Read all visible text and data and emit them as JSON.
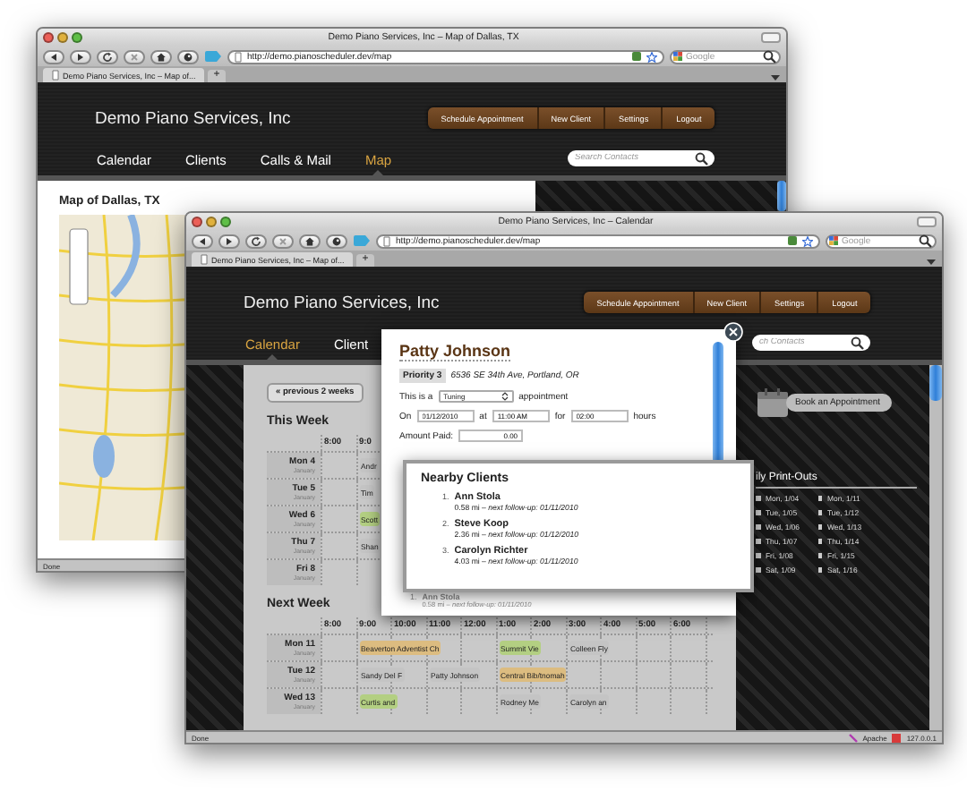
{
  "windows": [
    {
      "kind": "map",
      "title": "Demo Piano Services, Inc – Map of Dallas, TX",
      "url": "http://demo.pianoscheduler.dev/map",
      "web_search": {
        "placeholder": "Google"
      },
      "tab": "Demo Piano Services, Inc – Map of...",
      "new_tab": "+",
      "site": {
        "brand": "Demo Piano Services, Inc",
        "actions": [
          "Schedule Appointment",
          "New Client",
          "Settings",
          "Logout"
        ],
        "nav": [
          {
            "label": "Calendar",
            "selected": false
          },
          {
            "label": "Clients",
            "selected": false
          },
          {
            "label": "Calls & Mail",
            "selected": false
          },
          {
            "label": "Map",
            "selected": true
          }
        ],
        "search": {
          "placeholder": "Search Contacts"
        }
      },
      "map": {
        "title": "Map of Dallas, TX"
      },
      "status": [
        "Done"
      ]
    },
    {
      "kind": "calendar",
      "title": "Demo Piano Services, Inc – Calendar",
      "url": "http://demo.pianoscheduler.dev/map",
      "web_search": {
        "placeholder": "Google"
      },
      "tab": "Demo Piano Services, Inc – Map of...",
      "new_tab": "+",
      "site": {
        "brand": "Demo Piano Services, Inc",
        "actions": [
          "Schedule Appointment",
          "New Client",
          "Settings",
          "Logout"
        ],
        "nav": [
          {
            "label": "Calendar",
            "selected": true
          },
          {
            "label": "Client",
            "selected": false
          }
        ],
        "search": {
          "placeholder": "ch Contacts"
        }
      },
      "calendar": {
        "previous": "« previous 2 weeks",
        "weeks": [
          {
            "title": "This Week",
            "times": [
              "8:00",
              "9:0"
            ],
            "days": [
              {
                "day": "Mon 4",
                "month": "January",
                "cells": [
                  null,
                  {
                    "label": "Andr",
                    "color": "#c4c4c4"
                  }
                ]
              },
              {
                "day": "Tue 5",
                "month": "January",
                "cells": [
                  null,
                  {
                    "label": "Tim",
                    "color": "#c4c4c4"
                  }
                ]
              },
              {
                "day": "Wed 6",
                "month": "January",
                "cells": [
                  null,
                  {
                    "label": "Scott",
                    "color": "#b3cf82"
                  }
                ]
              },
              {
                "day": "Thu 7",
                "month": "January",
                "cells": [
                  null,
                  {
                    "label": "Shan",
                    "color": "#c4c4c4"
                  }
                ]
              },
              {
                "day": "Fri 8",
                "month": "January",
                "cells": [
                  null,
                  null
                ]
              }
            ]
          },
          {
            "title": "Next Week",
            "times": [
              "8:00",
              "9:00",
              "10:00",
              "11:00",
              "12:00",
              "1:00",
              "2:00",
              "3:00",
              "4:00",
              "5:00",
              "6:00"
            ],
            "days": [
              {
                "day": "Mon 11",
                "month": "January",
                "cells": [
                  null,
                  {
                    "label": "Beaverton Adventist Ch",
                    "color": "#dcbc80"
                  },
                  null,
                  null,
                  null,
                  {
                    "label": "Summit Vie",
                    "color": "#b3cf82"
                  },
                  null,
                  {
                    "label": "Colleen Fly",
                    "color": "#c4c4c4"
                  },
                  null,
                  null,
                  null
                ]
              },
              {
                "day": "Tue 12",
                "month": "January",
                "cells": [
                  null,
                  {
                    "label": "Sandy Del F",
                    "color": "#c4c4c4"
                  },
                  null,
                  {
                    "label": "Patty Johnson",
                    "color": "#c4c4c4"
                  },
                  null,
                  {
                    "label": "Central Bib/tnomah",
                    "color": "#dcbc80"
                  },
                  null,
                  null,
                  null,
                  null,
                  null
                ]
              },
              {
                "day": "Wed 13",
                "month": "January",
                "cells": [
                  null,
                  {
                    "label": "Curtis and",
                    "color": "#b3cf82"
                  },
                  null,
                  null,
                  null,
                  {
                    "label": "Rodney Me",
                    "color": "#c4c4c4"
                  },
                  null,
                  {
                    "label": "Carolyn an",
                    "color": "#c4c4c4"
                  },
                  null,
                  null,
                  null
                ]
              }
            ]
          }
        ]
      },
      "sidebar": {
        "book": "Book an Appointment",
        "title": "ily Print-Outs",
        "columns": [
          [
            "Mon, 1/04",
            "Tue, 1/05",
            "Wed, 1/06",
            "Thu, 1/07",
            "Fri, 1/08",
            "Sat, 1/09"
          ],
          [
            "Mon, 1/11",
            "Tue, 1/12",
            "Wed, 1/13",
            "Thu, 1/14",
            "Fri, 1/15",
            "Sat, 1/16"
          ]
        ]
      },
      "modal": {
        "name": "Patty Johnson",
        "priority": "Priority 3",
        "address": "6536 SE 34th Ave, Portland, OR",
        "type_prefix": "This is a",
        "type": "Tuning",
        "type_suffix": "appointment",
        "date_label": "On",
        "date": "01/12/2010",
        "time_label": "at",
        "time": "11:00 AM",
        "duration_label": "for",
        "duration": "02:00",
        "duration_unit": "hours",
        "paid_label": "Amount Paid:",
        "paid": "0.00",
        "list": [
          {
            "number": "1.",
            "name": "Ann Stola",
            "detail": "0.58 mi – *next follow-up: 01/11/2010*"
          }
        ]
      },
      "popup": {
        "title": "Nearby Clients",
        "clients": [
          {
            "number": "1.",
            "name": "Ann Stola",
            "detail": "0.58 mi – *next follow-up: 01/11/2010*"
          },
          {
            "number": "2.",
            "name": "Steve Koop",
            "detail": "2.36 mi – *next follow-up: 01/12/2010*"
          },
          {
            "number": "3.",
            "name": "Carolyn Richter",
            "detail": "4.03 mi – *next follow-up: 01/11/2010*"
          }
        ]
      },
      "status": [
        "Done",
        "Apache",
        "127.0.0.1"
      ]
    }
  ]
}
